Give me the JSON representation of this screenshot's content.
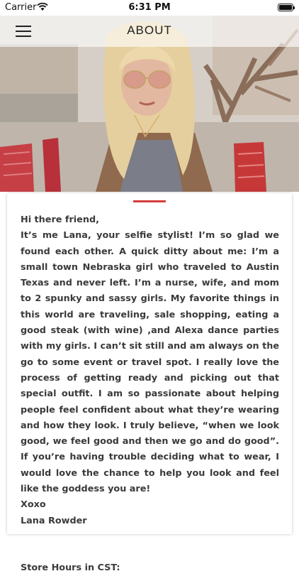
{
  "status_bar": {
    "carrier": "Carrier",
    "time": "6:31 PM",
    "battery_level": 1.0,
    "icons": [
      "wifi-icon",
      "battery-icon"
    ]
  },
  "nav": {
    "title": "ABOUT",
    "menu_icon": "hamburger-menu-icon"
  },
  "hero": {
    "alt_icon": "profile-photo"
  },
  "colors": {
    "accent": "#d33d3d",
    "text": "#3a3a3a"
  },
  "about": {
    "greeting": "Hi there friend,",
    "body": "It’s me Lana, your selfie stylist! I’m so glad we found each other. A quick ditty about me: I’m a small town Nebraska girl who traveled to Austin Texas and never left. I’m a nurse, wife, and mom to 2 spunky and sassy girls. My favorite things in this world are traveling, sale shopping, eating a good steak (with wine) ,and Alexa dance parties with my girls. I can’t sit still and am always on the go to some event or travel spot. I really love the process of getting ready and picking out that special outfit. I am so passionate about helping people feel confident about what they’re wearing and how they look. I truly believe, “when we look good, we feel good and then we go and do good”. If you’re having trouble deciding what to wear, I would love the chance to help you look and feel like the goddess you are!",
    "signoff": "Xoxo",
    "signature": "Lana Rowder",
    "store_hours_heading": "Store Hours in CST:"
  }
}
